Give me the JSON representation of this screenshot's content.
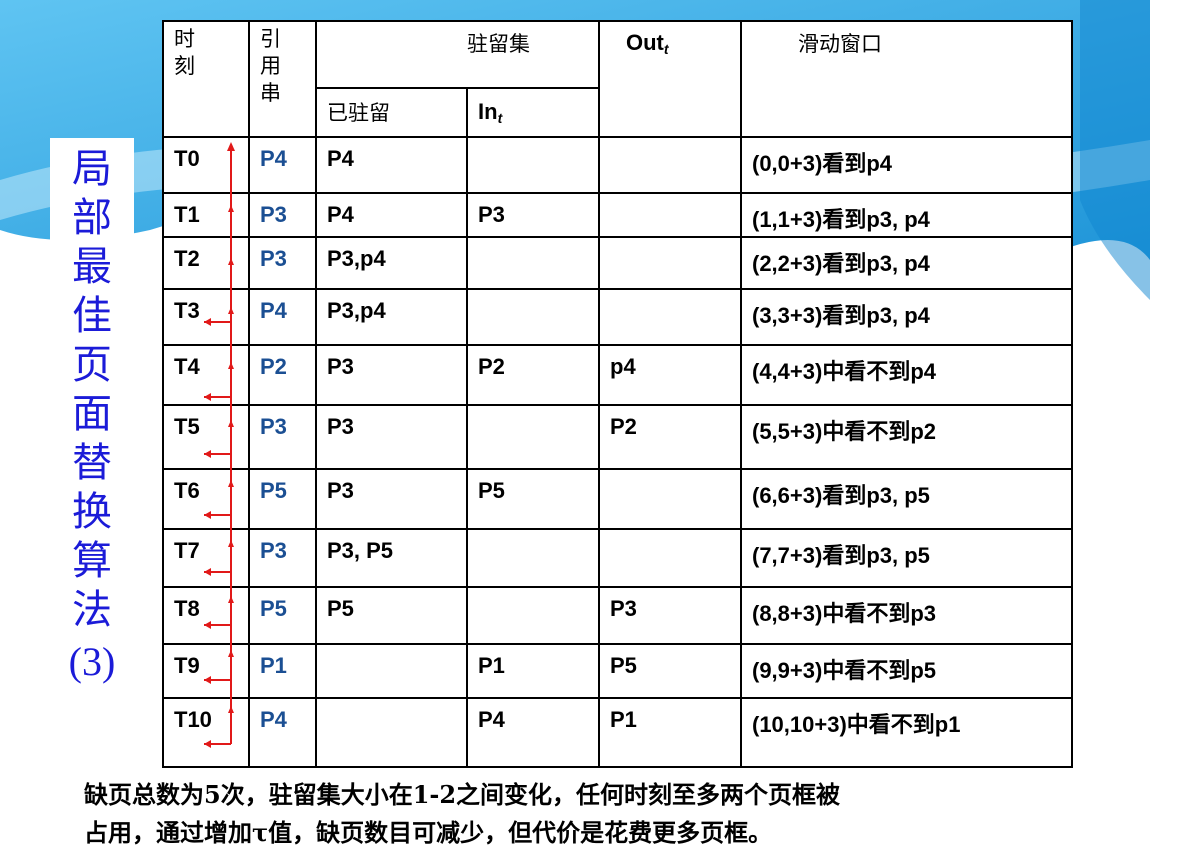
{
  "title": {
    "chars": [
      "局",
      "部",
      "最",
      "佳",
      "页",
      "面",
      "替",
      "换",
      "算",
      "法"
    ],
    "num": "(3)"
  },
  "headers": {
    "time": [
      "时",
      "刻"
    ],
    "ref": [
      "引",
      "用",
      "串"
    ],
    "resident_set": "驻留集",
    "resident": "已驻留",
    "in": "In",
    "in_sub": "t",
    "out": "Out",
    "out_sub": "t",
    "window": "滑动窗口"
  },
  "rows": [
    {
      "t": "T0",
      "ref": "P4",
      "resident": "P4",
      "in": "",
      "out": "",
      "window": "(0,0+3)看到p4"
    },
    {
      "t": "T1",
      "ref": "P3",
      "resident": "P4",
      "in": "P3",
      "out": "",
      "window": "(1,1+3)看到p3, p4"
    },
    {
      "t": "T2",
      "ref": "P3",
      "resident": "P3,p4",
      "in": "",
      "out": "",
      "window": "(2,2+3)看到p3, p4"
    },
    {
      "t": "T3",
      "ref": "P4",
      "resident": "P3,p4",
      "in": "",
      "out": "",
      "window": "(3,3+3)看到p3, p4"
    },
    {
      "t": "T4",
      "ref": "P2",
      "resident": "P3",
      "in": "P2",
      "out": "p4",
      "window": "(4,4+3)中看不到p4"
    },
    {
      "t": "T5",
      "ref": "P3",
      "resident": "P3",
      "in": "",
      "out": "P2",
      "window": "(5,5+3)中看不到p2"
    },
    {
      "t": "T6",
      "ref": "P5",
      "resident": "P3",
      "in": "P5",
      "out": "",
      "window": "(6,6+3)看到p3, p5"
    },
    {
      "t": "T7",
      "ref": "P3",
      "resident": "P3, P5",
      "in": "",
      "out": "",
      "window": "(7,7+3)看到p3, p5"
    },
    {
      "t": "T8",
      "ref": "P5",
      "resident": "P5",
      "in": "",
      "out": "P3",
      "window": "(8,8+3)中看不到p3"
    },
    {
      "t": "T9",
      "ref": "P1",
      "resident": "",
      "in": "P1",
      "out": "P5",
      "window": "(9,9+3)中看不到p5"
    },
    {
      "t": "T10",
      "ref": "P4",
      "resident": "",
      "in": "P4",
      "out": "P1",
      "window": "(10,10+3)中看不到p1"
    }
  ],
  "footer": [
    "缺页总数为5次，驻留集大小在1-2之间变化，任何时刻至多两个页框被",
    "占用，通过增加τ值，缺页数目可减少，但代价是花费更多页框。"
  ],
  "colors": {
    "title": "#1b1bd8",
    "ref": "#1b4f93",
    "arrow": "#e11919",
    "banner": "#2aa5e6"
  }
}
